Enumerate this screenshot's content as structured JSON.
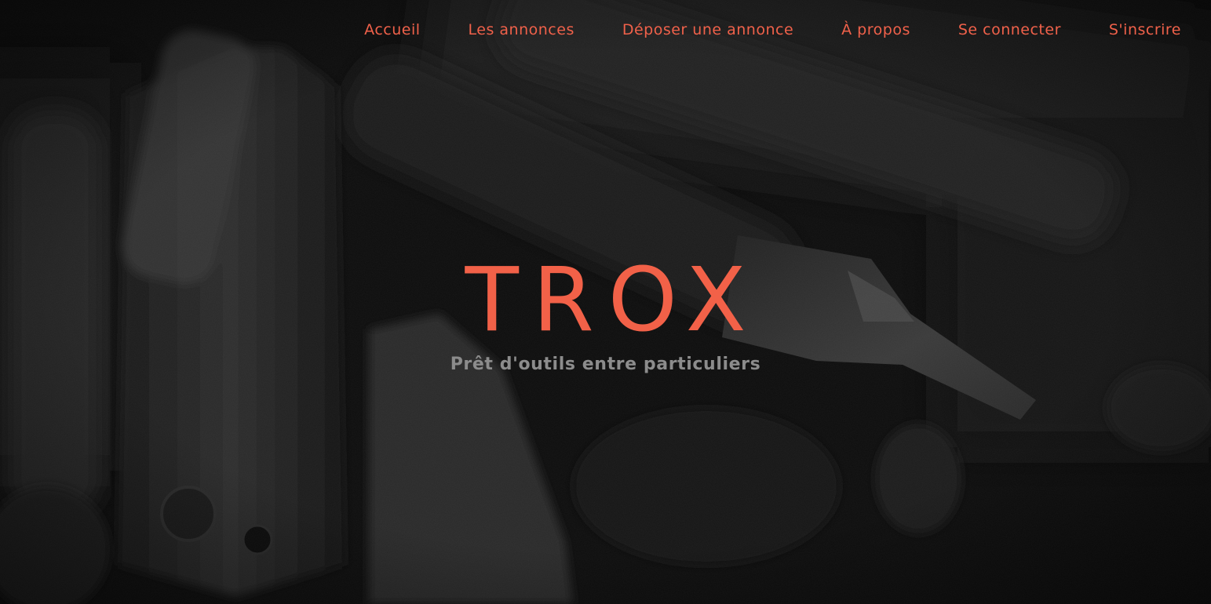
{
  "colors": {
    "accent": "#f26148",
    "subtitle": "#8c8c8c",
    "background": "#0c0c0c"
  },
  "nav": {
    "items": [
      {
        "label": "Accueil"
      },
      {
        "label": "Les annonces"
      },
      {
        "label": "Déposer une annonce"
      },
      {
        "label": "À propos"
      },
      {
        "label": "Se connecter"
      },
      {
        "label": "S'inscrire"
      }
    ]
  },
  "hero": {
    "title": "TROX",
    "subtitle": "Prêt d'outils entre particuliers",
    "background_image": "dark-tools-photo"
  }
}
